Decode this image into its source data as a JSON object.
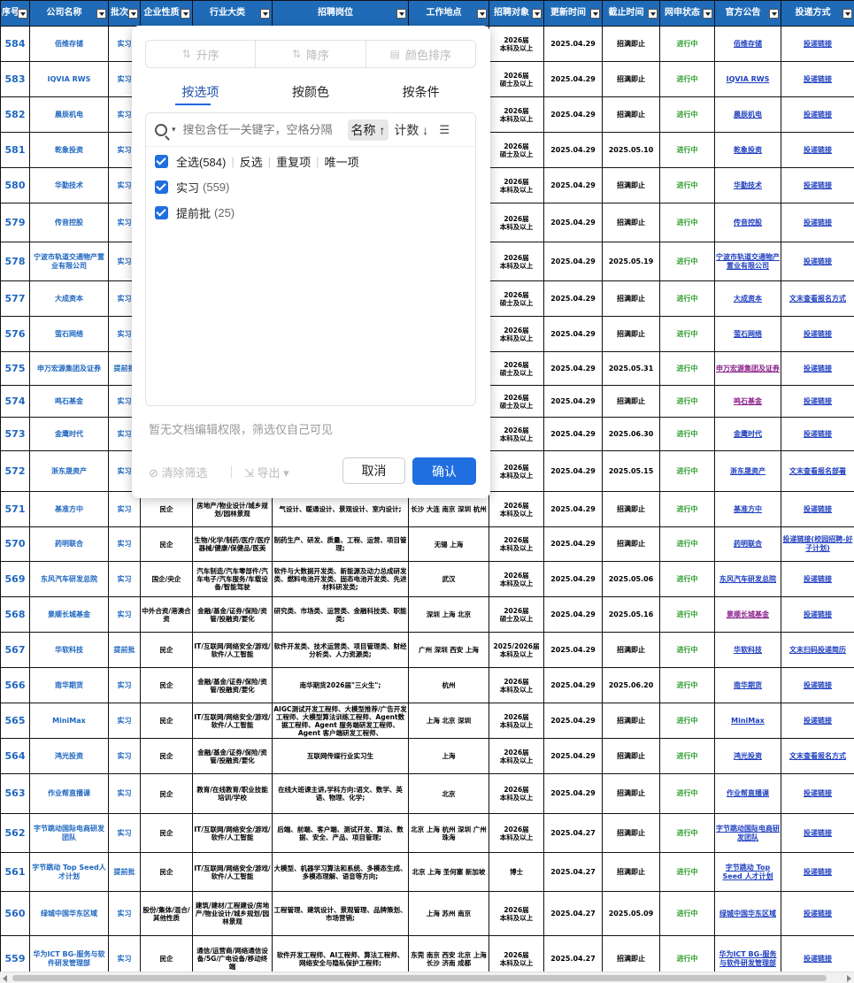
{
  "columns": [
    "序号",
    "公司名称",
    "批次",
    "企业性质",
    "行业大类",
    "招聘岗位",
    "工作地点",
    "招聘对象",
    "更新时间",
    "截止时间",
    "网申状态",
    "官方公告",
    "投递方式"
  ],
  "rows": [
    {
      "no": "584",
      "company": "佰维存储",
      "batch": "实习",
      "nature": "",
      "industry": "",
      "positions": "",
      "location": "",
      "target": "2026届\n本科及以上",
      "updated": "2025.04.29",
      "deadline": "招满即止",
      "status": "进行中",
      "notice": "佰维存储",
      "apply": "投递链接"
    },
    {
      "no": "583",
      "company": "IQVIA RWS",
      "batch": "实习",
      "nature": "",
      "industry": "",
      "positions": "",
      "location": "",
      "target": "2026届\n硕士及以上",
      "updated": "2025.04.29",
      "deadline": "招满即止",
      "status": "进行中",
      "notice": "IQVIA RWS",
      "apply": "投递链接"
    },
    {
      "no": "582",
      "company": "晨辰机电",
      "batch": "实习",
      "nature": "",
      "industry": "",
      "positions": "",
      "location": "",
      "target": "2026届\n本科及以上",
      "updated": "2025.04.29",
      "deadline": "招满即止",
      "status": "进行中",
      "notice": "晨辰机电",
      "apply": "投递链接"
    },
    {
      "no": "581",
      "company": "乾象投资",
      "batch": "实习",
      "nature": "",
      "industry": "",
      "positions": "",
      "location": "",
      "target": "2026届\n硕士及以上",
      "updated": "2025.04.29",
      "deadline": "2025.05.10",
      "status": "进行中",
      "notice": "乾象投资",
      "apply": "投递链接"
    },
    {
      "no": "580",
      "company": "华勤技术",
      "batch": "实习",
      "nature": "",
      "industry": "",
      "positions": "",
      "location": "",
      "target": "2026届\n本科及以上",
      "updated": "2025.04.29",
      "deadline": "招满即止",
      "status": "进行中",
      "notice": "华勤技术",
      "apply": "投递链接"
    },
    {
      "no": "579",
      "company": "传音控股",
      "batch": "实习",
      "nature": "",
      "industry": "",
      "positions": "",
      "location": "",
      "target": "2026届\n本科及以上",
      "updated": "2025.04.29",
      "deadline": "招满即止",
      "status": "进行中",
      "notice": "传音控股",
      "apply": "投递链接"
    },
    {
      "no": "578",
      "company": "宁波市轨道交通物产置业有限公司",
      "batch": "实习",
      "nature": "",
      "industry": "",
      "positions": "",
      "location": "",
      "target": "2026届\n本科及以上",
      "updated": "2025.04.29",
      "deadline": "2025.05.19",
      "status": "进行中",
      "notice": "宁波市轨道交通物产置业有限公司",
      "apply": "投递链接"
    },
    {
      "no": "577",
      "company": "大成资本",
      "batch": "实习",
      "nature": "",
      "industry": "",
      "positions": "",
      "location": "",
      "target": "2026届\n硕士及以上",
      "updated": "2025.04.29",
      "deadline": "招满即止",
      "status": "进行中",
      "notice": "大成资本",
      "apply": "文末查看报名方式"
    },
    {
      "no": "576",
      "company": "萤石网络",
      "batch": "实习",
      "nature": "",
      "industry": "",
      "positions": "",
      "location": "",
      "target": "2026届\n本科及以上",
      "updated": "2025.04.29",
      "deadline": "招满即止",
      "status": "进行中",
      "notice": "萤石网络",
      "apply": "投递链接"
    },
    {
      "no": "575",
      "company": "申万宏源集团及证券",
      "batch": "提前批",
      "nature": "",
      "industry": "",
      "positions": "",
      "location": "",
      "target": "2026届\n硕士及以上",
      "updated": "2025.04.29",
      "deadline": "2025.05.31",
      "status": "进行中",
      "notice": "申万宏源集团及证券",
      "apply": "投递链接"
    },
    {
      "no": "574",
      "company": "鸣石基金",
      "batch": "实习",
      "nature": "",
      "industry": "",
      "positions": "",
      "location": "",
      "target": "2026届\n硕士及以上",
      "updated": "2025.04.29",
      "deadline": "招满即止",
      "status": "进行中",
      "notice": "鸣石基金",
      "apply": "投递链接"
    },
    {
      "no": "573",
      "company": "金鹰时代",
      "batch": "实习",
      "nature": "",
      "industry": "",
      "positions": "",
      "location": "",
      "target": "2026届\n本科及以上",
      "updated": "2025.04.29",
      "deadline": "2025.06.30",
      "status": "进行中",
      "notice": "金鹰时代",
      "apply": "投递链接"
    },
    {
      "no": "572",
      "company": "浙东晟资产",
      "batch": "实习",
      "nature": "",
      "industry": "",
      "positions": "",
      "location": "",
      "target": "2026届\n本科及以上",
      "updated": "2025.04.29",
      "deadline": "2025.05.15",
      "status": "进行中",
      "notice": "浙东晟资产",
      "apply": "文末查看报名部署"
    },
    {
      "no": "571",
      "company": "基准方中",
      "batch": "实习",
      "nature": "民企",
      "industry": "房地产/物业设计/城乡规划/园林景观",
      "positions": "气设计、暖通设计、景观设计、室内设计;",
      "location": "长沙 大连 南京 深圳 杭州",
      "target": "2026届\n本科及以上",
      "updated": "2025.04.29",
      "deadline": "招满即止",
      "status": "进行中",
      "notice": "基准方中",
      "apply": "投递链接"
    },
    {
      "no": "570",
      "company": "药明联合",
      "batch": "实习",
      "nature": "民企",
      "industry": "生物/化学/制药/医疗/医疗器械/健康/保健品/医美",
      "positions": "制药生产、研发、质量、工程、运营、项目管理;",
      "location": "无锡 上海",
      "target": "2026届\n本科及以上",
      "updated": "2025.04.29",
      "deadline": "招满即止",
      "status": "进行中",
      "notice": "药明联合",
      "apply": "投递链接(校园招聘-好子计划)"
    },
    {
      "no": "569",
      "company": "东风汽车研发总院",
      "batch": "实习",
      "nature": "国企/央企",
      "industry": "汽车制造/汽车零部件/汽车电子/汽车服务/车载设备/智能驾驶",
      "positions": "软件与大数据开发类、新能源及动力总成研发类、燃料电池开发类、固态电池开发类、先进材料研发类;",
      "location": "武汉",
      "target": "2026届\n本科及以上",
      "updated": "2025.04.29",
      "deadline": "2025.05.06",
      "status": "进行中",
      "notice": "东风汽车研发总院",
      "apply": "投递链接"
    },
    {
      "no": "568",
      "company": "景顺长城基金",
      "batch": "实习",
      "nature": "中外合资/港澳合资",
      "industry": "金融/基金/证券/保险/资管/投融资/要化",
      "positions": "研究类、市场类、运营类、金融科技类、职能类;",
      "location": "深圳 上海 北京",
      "target": "2026届\n硕士及以上",
      "updated": "2025.04.29",
      "deadline": "2025.05.16",
      "status": "进行中",
      "notice": "景顺长城基金",
      "apply": "投递链接"
    },
    {
      "no": "567",
      "company": "华软科技",
      "batch": "提前批",
      "nature": "民企",
      "industry": "IT/互联网/网络安全/游戏/软件/人工智能",
      "positions": "软件开发类、技术运营类、项目管理类、财经分析类、人力资源类;",
      "location": "广州 深圳 西安 上海",
      "target": "2025/2026届\n本科及以上",
      "updated": "2025.04.29",
      "deadline": "招满即止",
      "status": "进行中",
      "notice": "华软科技",
      "apply": "文末扫码投递简历"
    },
    {
      "no": "566",
      "company": "南华期货",
      "batch": "实习",
      "nature": "民企",
      "industry": "金融/基金/证券/保险/资管/投融资/要化",
      "positions": "南华期货2026届\"三火生\";",
      "location": "杭州",
      "target": "2026届\n本科及以上",
      "updated": "2025.04.29",
      "deadline": "2025.06.20",
      "status": "进行中",
      "notice": "南华期货",
      "apply": "投递链接"
    },
    {
      "no": "565",
      "company": "MiniMax",
      "batch": "实习",
      "nature": "民企",
      "industry": "IT/互联网/网络安全/游戏/软件/人工智能",
      "positions": "AIGC测试开发工程师、大模型推荐/广告开发工程师、大模型算法训练工程师、Agent数据工程师、Agent 服务端研发工程师、Agent 客户端研发工程师、",
      "location": "上海 北京 深圳",
      "target": "2026届\n本科及以上",
      "updated": "2025.04.29",
      "deadline": "招满即止",
      "status": "进行中",
      "notice": "MiniMax",
      "apply": "投递链接"
    },
    {
      "no": "564",
      "company": "鸿光投资",
      "batch": "实习",
      "nature": "民企",
      "industry": "金融/基金/证券/保险/资管/投融资/要化",
      "positions": "互联网传媒行业实习生",
      "location": "上海",
      "target": "2026届\n本科及以上",
      "updated": "2025.04.29",
      "deadline": "招满即止",
      "status": "进行中",
      "notice": "鸿光投资",
      "apply": "文末查看报名方式"
    },
    {
      "no": "563",
      "company": "作业帮直播课",
      "batch": "实习",
      "nature": "民企",
      "industry": "教育/在线教育/职业技能培训/学校",
      "positions": "在线大班课主讲,学科方向:语文、数学、英语、物理、化学;",
      "location": "北京",
      "target": "2026届\n本科及以上",
      "updated": "2025.04.29",
      "deadline": "招满即止",
      "status": "进行中",
      "notice": "作业帮直播课",
      "apply": "投递链接"
    },
    {
      "no": "562",
      "company": "字节跳动国际电商研发团队",
      "batch": "实习",
      "nature": "民企",
      "industry": "IT/互联网/网络安全/游戏/软件/人工智能",
      "positions": "后端、前端、客户端、测试开发、算法、数据、安全、产品、项目管理;",
      "location": "北京 上海 杭州 深圳 广州 珠海",
      "target": "2026届\n本科及以上",
      "updated": "2025.04.27",
      "deadline": "招满即止",
      "status": "进行中",
      "notice": "字节跳动国际电商研发团队",
      "apply": "投递链接"
    },
    {
      "no": "561",
      "company": "字节跳动 Top Seed人才计划",
      "batch": "提前批",
      "nature": "民企",
      "industry": "IT/互联网/网络安全/游戏/软件/人工智能",
      "positions": "大模型、机器学习算法和系统、多模态生成、多模态理解、语音等方向;",
      "location": "北京 上海 圣何塞 新加坡",
      "target": "博士",
      "updated": "2025.04.27",
      "deadline": "招满即止",
      "status": "进行中",
      "notice": "字节跳动 Top Seed 人才计划",
      "apply": "投递链接"
    },
    {
      "no": "560",
      "company": "绿城中国华东区域",
      "batch": "实习",
      "nature": "股份/集体/混合/其他性质",
      "industry": "建筑/建材/工程建设/房地产/物业设计/城乡规划/园林景观",
      "positions": "工程管理、建筑设计、景观管理、品牌策划、市场营销;",
      "location": "上海 苏州 南京",
      "target": "2026届\n本科及以上",
      "updated": "2025.04.27",
      "deadline": "2025.05.09",
      "status": "进行中",
      "notice": "绿城中国华东区域",
      "apply": "投递链接"
    },
    {
      "no": "559",
      "company": "华为ICT BG-服务与软件研发管理部",
      "batch": "实习",
      "nature": "民企",
      "industry": "通信/运营商/网络通信设备/5G/广电设备/移动终端",
      "positions": "软件开发工程师、AI工程师、算法工程师、网络安全与隐私保护工程师;",
      "location": "东莞 南京 西安 北京 上海 长沙 济南 成都",
      "target": "2026届\n本科及以上",
      "updated": "2025.04.27",
      "deadline": "招满即止",
      "status": "进行中",
      "notice": "华为ICT BG-服务与软件研发管理部",
      "apply": "投递链接"
    }
  ],
  "filter": {
    "sort_asc": "升序",
    "sort_desc": "降序",
    "sort_color": "颜色排序",
    "tabs": [
      "按选项",
      "按颜色",
      "按条件"
    ],
    "search_placeholder": "搜包含任一关键字，空格分隔",
    "name_sort": "名称 ↑",
    "count_sort": "计数 ↓",
    "select_all": "全选(584)",
    "invert": "反选",
    "duplicates": "重复项",
    "unique": "唯一项",
    "options": [
      {
        "label": "实习",
        "count": "(559)"
      },
      {
        "label": "提前批",
        "count": "(25)"
      }
    ],
    "note": "暂无文档编辑权限，筛选仅自己可见",
    "clear": "清除筛选",
    "export": "导出",
    "cancel": "取消",
    "confirm": "确认"
  },
  "colors": {
    "header": "#1f6bb8",
    "accent": "#1f6fe0",
    "status": "#2e9e2e",
    "link": "#1f3fbf"
  }
}
